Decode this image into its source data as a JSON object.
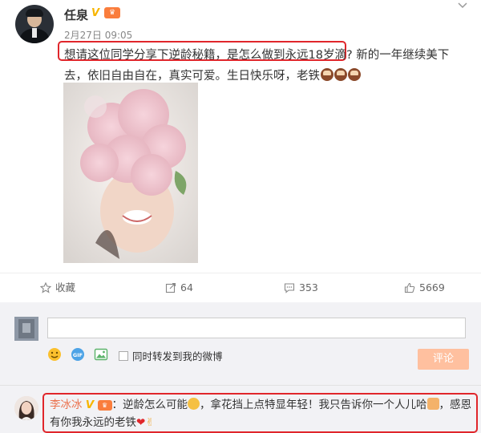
{
  "post": {
    "username": "任泉",
    "vip_badge": "V",
    "member_badge": "会员",
    "timestamp": "2月27日 09:05",
    "highlighted_text": "想请这位同学分享下逆龄秘籍，是怎么做到永远18岁滴?",
    "text_rest": " 新的一年继续美下去，依旧自由自在，真实可爱。生日快乐呀，老铁",
    "cake_emojis": [
      "cake-icon",
      "cake-icon",
      "cake-icon"
    ]
  },
  "actions": {
    "favorite_label": "收藏",
    "repost_count": "64",
    "comment_count": "353",
    "like_count": "5669"
  },
  "comment_box": {
    "placeholder": "",
    "forward_label": "同时转发到我的微博",
    "submit_label": "评论"
  },
  "reply": {
    "name": "李冰冰",
    "vip_badge": "V",
    "member_badge": "会员",
    "part1": "：逆龄怎么可能",
    "part2": "，拿花挡上点特显年轻！我只告诉你一个人儿哈",
    "part3": "，感恩有你我永远的老铁"
  },
  "colors": {
    "accent_orange": "#fa7d3c",
    "highlight_red": "#e0262b",
    "link_orange": "#eb7350",
    "vip_gold": "#f7b500"
  }
}
